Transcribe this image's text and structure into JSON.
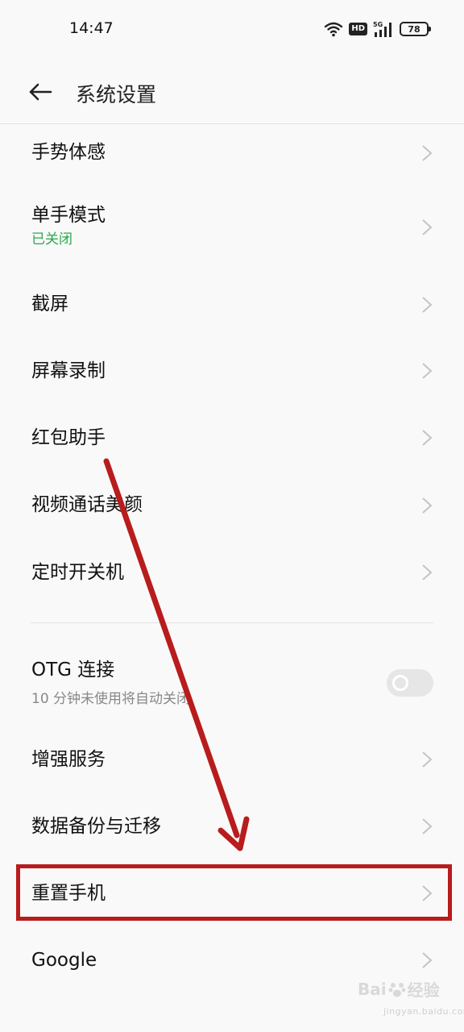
{
  "status_bar": {
    "time": "14:47",
    "network_badge": "HD",
    "network_type": "5G",
    "battery": "78"
  },
  "header": {
    "title": "系统设置"
  },
  "list": {
    "gesture": {
      "label": "手势体感"
    },
    "one_hand": {
      "label": "单手模式",
      "sub": "已关闭"
    },
    "screenshot": {
      "label": "截屏"
    },
    "screen_record": {
      "label": "屏幕录制"
    },
    "red_packet": {
      "label": "红包助手"
    },
    "video_beauty": {
      "label": "视频通话美颜"
    },
    "scheduled_power": {
      "label": "定时开关机"
    },
    "otg": {
      "label": "OTG 连接",
      "sub": "10 分钟未使用将自动关闭",
      "enabled": false
    },
    "enhanced_services": {
      "label": "增强服务"
    },
    "backup_migrate": {
      "label": "数据备份与迁移"
    },
    "reset_phone": {
      "label": "重置手机"
    },
    "google": {
      "label": "Google"
    }
  },
  "colors": {
    "accent_green": "#2ba74b",
    "annotation_red": "#b81c1c"
  },
  "watermark": {
    "text": "Bai",
    "text2": "经验",
    "sub": "jingyan.baidu.com"
  }
}
